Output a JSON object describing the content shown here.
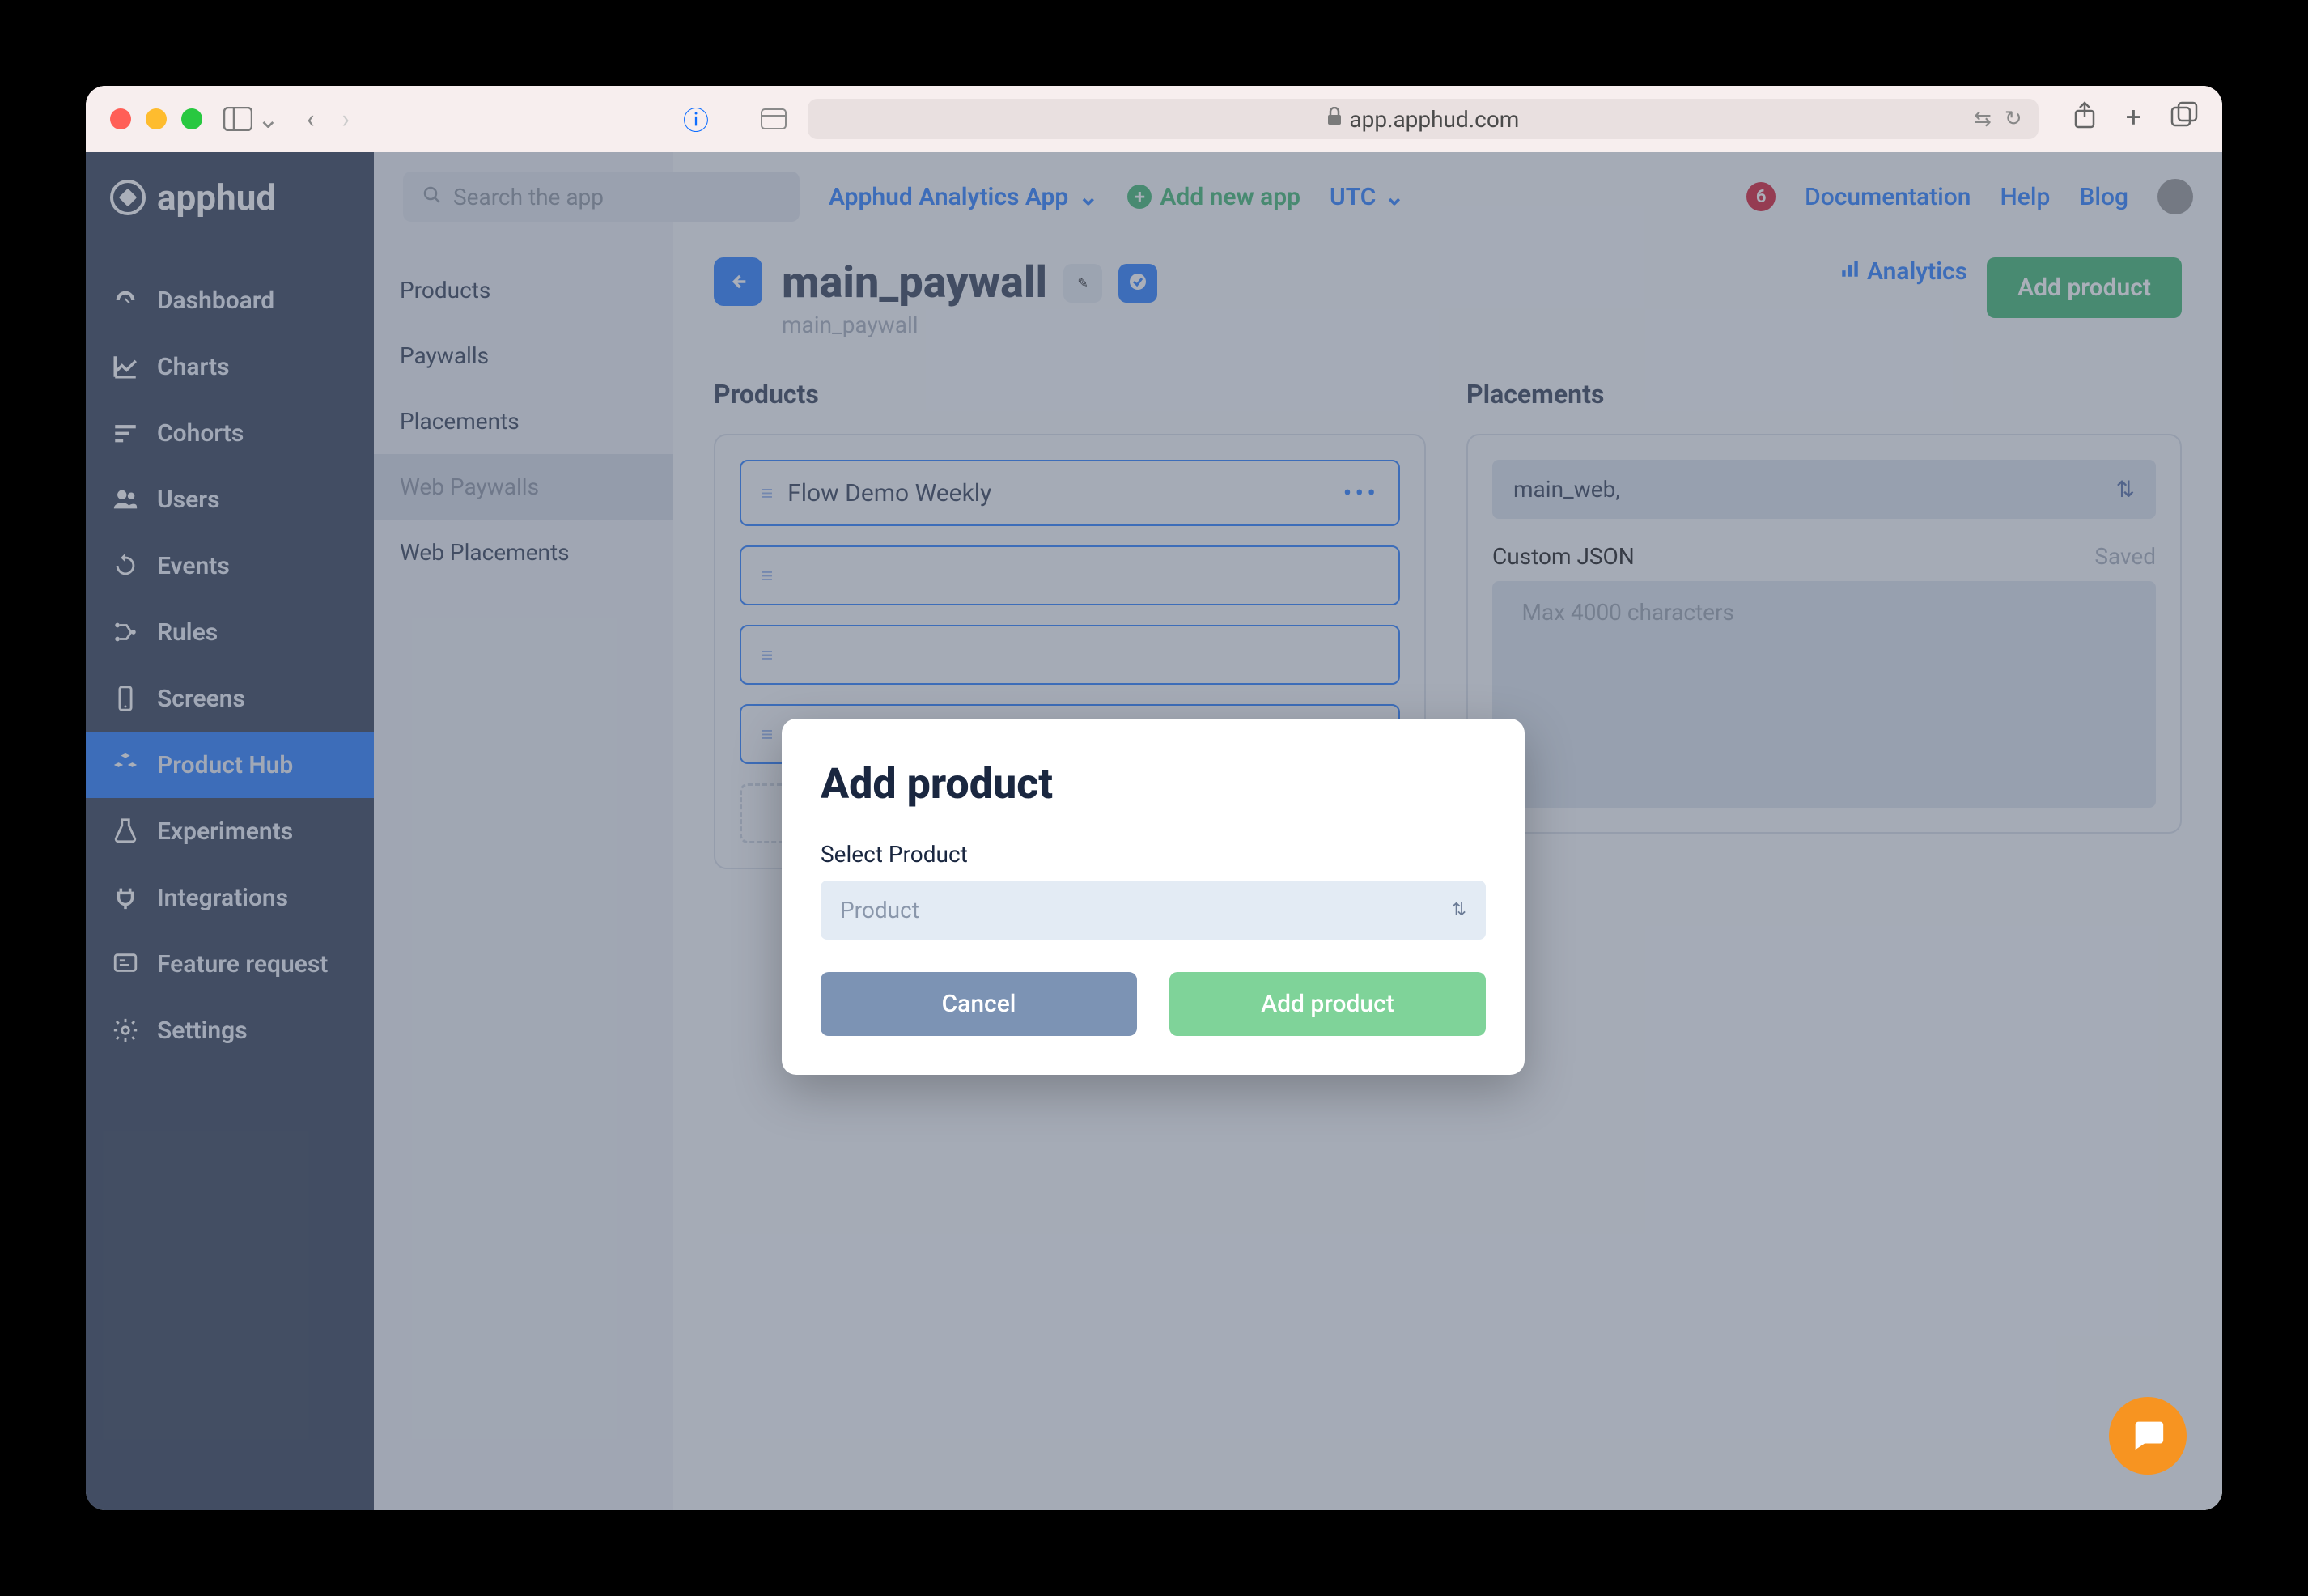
{
  "browser": {
    "url": "app.apphud.com"
  },
  "logo_text": "apphud",
  "sidebar": {
    "items": [
      {
        "label": "Dashboard",
        "active": false
      },
      {
        "label": "Charts",
        "active": false
      },
      {
        "label": "Cohorts",
        "active": false
      },
      {
        "label": "Users",
        "active": false
      },
      {
        "label": "Events",
        "active": false
      },
      {
        "label": "Rules",
        "active": false
      },
      {
        "label": "Screens",
        "active": false
      },
      {
        "label": "Product Hub",
        "active": true
      },
      {
        "label": "Experiments",
        "active": false
      },
      {
        "label": "Integrations",
        "active": false
      },
      {
        "label": "Feature request",
        "active": false
      },
      {
        "label": "Settings",
        "active": false
      }
    ]
  },
  "sub_sidebar": {
    "items": [
      {
        "label": "Products",
        "active": false
      },
      {
        "label": "Paywalls",
        "active": false
      },
      {
        "label": "Placements",
        "active": false
      },
      {
        "label": "Web Paywalls",
        "active": true
      },
      {
        "label": "Web Placements",
        "active": false
      }
    ]
  },
  "topbar": {
    "search_placeholder": "Search the app",
    "app_name": "Apphud Analytics App",
    "add_app_label": "Add new app",
    "timezone": "UTC",
    "notif_count": "6",
    "links": {
      "doc": "Documentation",
      "help": "Help",
      "blog": "Blog"
    }
  },
  "page": {
    "title": "main_paywall",
    "subtitle": "main_paywall",
    "analytics_label": "Analytics",
    "add_product_label": "Add product",
    "products_heading": "Products",
    "placements_heading": "Placements",
    "product_row_label": "Flow Demo Weekly",
    "placement_value": "main_web,",
    "custom_json_label": "Custom JSON",
    "saved_label": "Saved",
    "json_placeholder": "Max 4000 characters"
  },
  "modal": {
    "title": "Add product",
    "select_label": "Select Product",
    "select_placeholder": "Product",
    "cancel_label": "Cancel",
    "submit_label": "Add product"
  }
}
